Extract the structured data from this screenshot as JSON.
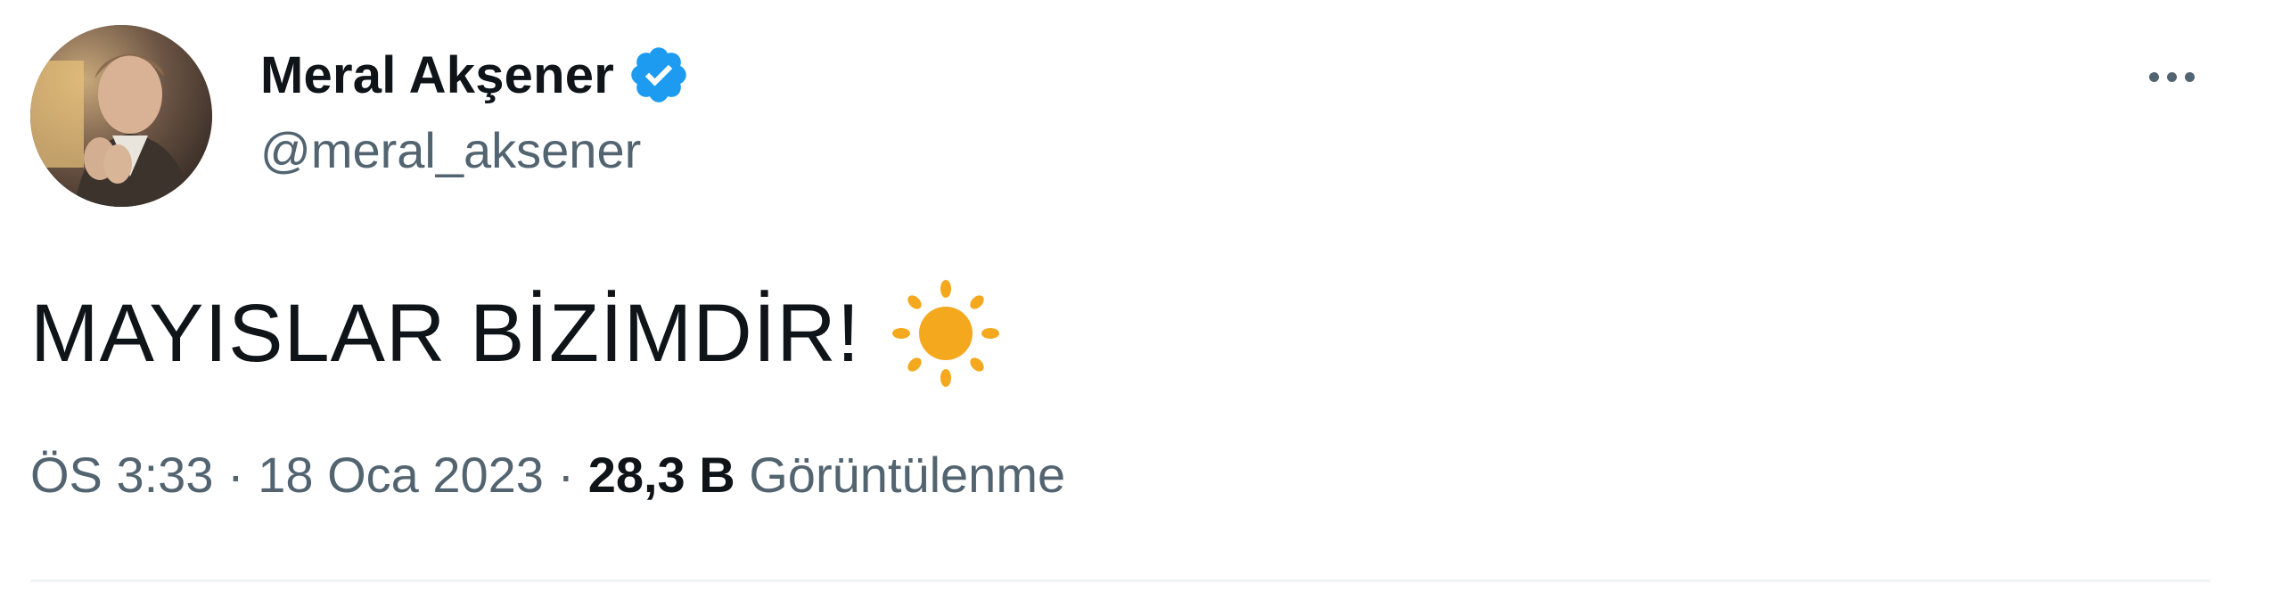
{
  "author": {
    "display_name": "Meral Akşener",
    "handle": "@meral_aksener",
    "verified": true
  },
  "tweet": {
    "text": "MAYISLAR BİZİMDİR!",
    "emoji": "sun-icon"
  },
  "meta": {
    "time": "ÖS 3:33",
    "separator": " · ",
    "date": "18 Oca 2023",
    "views_count": "28,3 B",
    "views_label": "Görüntülenme"
  },
  "colors": {
    "text": "#0f1419",
    "secondary": "#536471",
    "verified": "#1d9bf0",
    "sun": "#f4a81d"
  }
}
